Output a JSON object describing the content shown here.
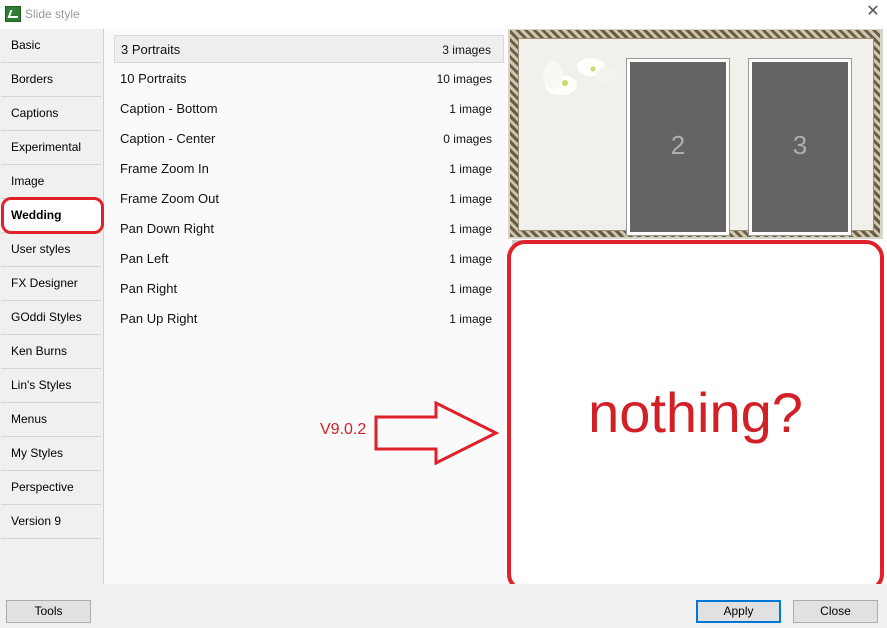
{
  "window": {
    "title": "Slide style"
  },
  "sidebar": {
    "items": [
      {
        "label": "Basic"
      },
      {
        "label": "Borders"
      },
      {
        "label": "Captions"
      },
      {
        "label": "Experimental"
      },
      {
        "label": "Image"
      },
      {
        "label": "Wedding",
        "selected": true
      },
      {
        "label": "User styles"
      },
      {
        "label": "FX Designer"
      },
      {
        "label": "GOddi Styles"
      },
      {
        "label": "Ken Burns"
      },
      {
        "label": "Lin's Styles"
      },
      {
        "label": "Menus"
      },
      {
        "label": "My Styles"
      },
      {
        "label": "Perspective"
      },
      {
        "label": "Version 9"
      }
    ]
  },
  "styles": {
    "rows": [
      {
        "name": "3 Portraits",
        "count": "3 images",
        "selected": true
      },
      {
        "name": "10 Portraits",
        "count": "10 images"
      },
      {
        "name": "Caption - Bottom",
        "count": "1 image"
      },
      {
        "name": "Caption - Center",
        "count": "0 images"
      },
      {
        "name": "Frame Zoom In",
        "count": "1 image"
      },
      {
        "name": "Frame Zoom Out",
        "count": "1 image"
      },
      {
        "name": "Pan Down Right",
        "count": "1 image"
      },
      {
        "name": "Pan Left",
        "count": "1 image"
      },
      {
        "name": "Pan Right",
        "count": "1 image"
      },
      {
        "name": "Pan Up Right",
        "count": "1 image"
      }
    ]
  },
  "preview": {
    "photo_2": "2",
    "photo_3": "3"
  },
  "annotation": {
    "nothing_text": "nothing?",
    "version_label": "V9.0.2",
    "color": "#e0202b"
  },
  "buttons": {
    "tools": "Tools",
    "apply": "Apply",
    "close": "Close"
  }
}
